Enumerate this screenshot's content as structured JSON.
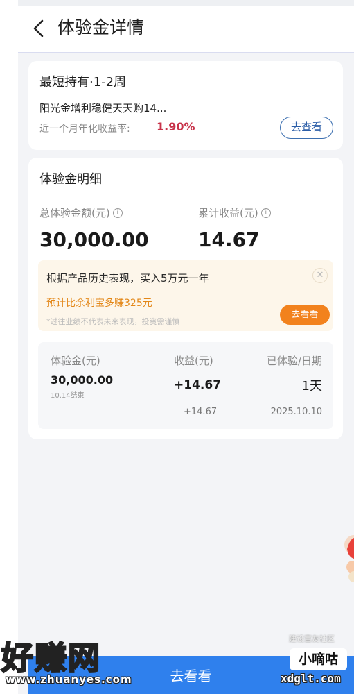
{
  "header": {
    "title": "体验金详情"
  },
  "product": {
    "term": "最短持有·1-2周",
    "name": "阳光金增利稳健天天购14...",
    "rate_label": "近一个月年化收益率:",
    "rate_value": "1.90%",
    "view_button": "去查看"
  },
  "details": {
    "title": "体验金明细",
    "total_label": "总体验金额(元)",
    "total_value": "30,000.00",
    "earn_label": "累计收益(元)",
    "earn_value": "14.67",
    "promo": {
      "text": "根据产品历史表现，买入5万元一年",
      "gain": "预计比余利宝多赚325元",
      "note": "*过往业绩不代表未来表现，投资需谨慎",
      "button": "去看看",
      "close_glyph": "✕"
    },
    "table": {
      "headers": [
        "体验金(元)",
        "收益(元)",
        "已体验/日期"
      ],
      "amount": "30,000.00",
      "end_note": "10.14结束",
      "earn": "+14.67",
      "days": "1天",
      "row2_earn": "+14.67",
      "row2_date": "2025.10.10"
    }
  },
  "bottom_button": "去看看",
  "watermark": {
    "left_big": "好赚网",
    "left_url": "www.zhuanyes.com",
    "right_small": "建设富友社区",
    "right_badge": "小嘀咕",
    "right_domain": "xdglt.com"
  },
  "colors": {
    "accent_blue": "#2f80ed",
    "rate_red": "#c8334a",
    "promo_orange": "#f2821d"
  },
  "icons": [
    "back-arrow-icon",
    "info-icon",
    "close-icon"
  ]
}
